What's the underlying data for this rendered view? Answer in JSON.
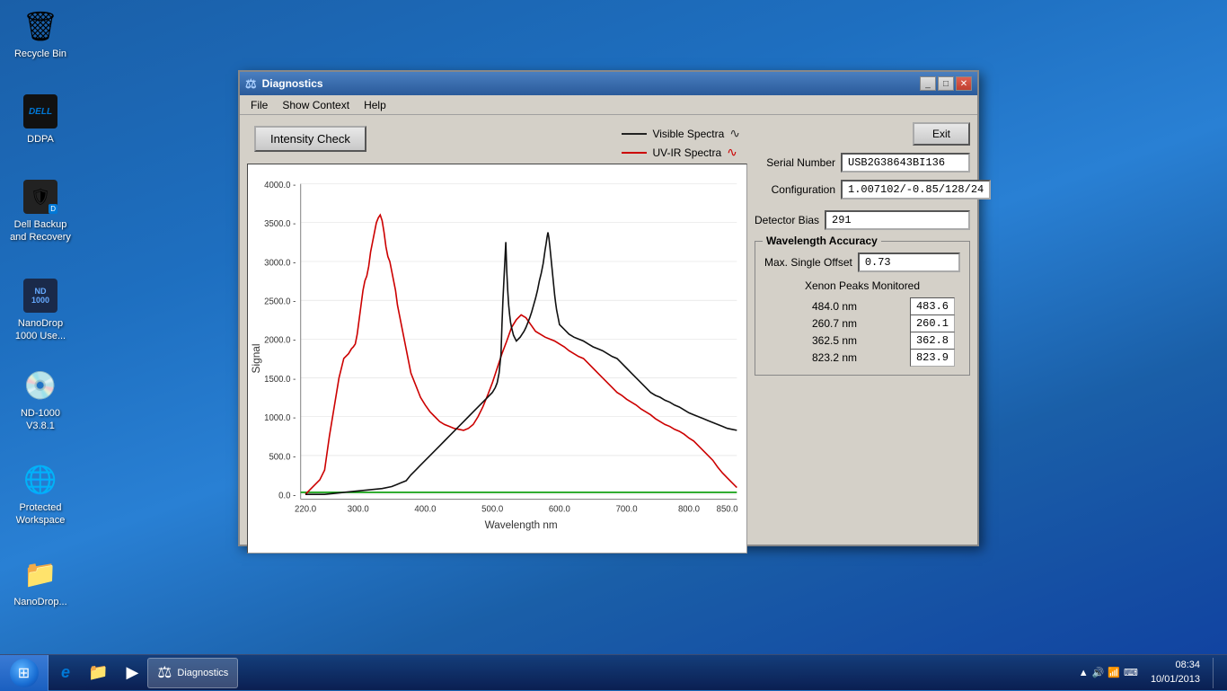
{
  "desktop": {
    "icons": [
      {
        "id": "recycle-bin",
        "label": "Recycle Bin",
        "symbol": "🗑"
      },
      {
        "id": "ddpa",
        "label": "DDPA",
        "symbol": "🛡"
      },
      {
        "id": "dell-backup",
        "label": "Dell Backup\nand Recovery",
        "symbol": "DELL"
      },
      {
        "id": "nanodrop-use",
        "label": "NanoDrop\n1000 Use...",
        "symbol": "ND"
      },
      {
        "id": "nd-1000",
        "label": "ND-1000\nV3.8.1",
        "symbol": "📀"
      },
      {
        "id": "protected-workspace",
        "label": "Protected\nWorkspace",
        "symbol": "🌐"
      },
      {
        "id": "nanodrop-folder",
        "label": "NanoDrop...",
        "symbol": "📁"
      }
    ]
  },
  "taskbar": {
    "start_label": "",
    "items": [
      {
        "id": "ie",
        "symbol": "e",
        "label": ""
      },
      {
        "id": "explorer",
        "symbol": "📁",
        "label": ""
      },
      {
        "id": "media",
        "symbol": "▶",
        "label": ""
      },
      {
        "id": "diagnostics",
        "symbol": "⚖",
        "label": "Diagnostics",
        "active": true
      }
    ],
    "clock_time": "08:34",
    "clock_date": "10/01/2013"
  },
  "window": {
    "title": "Diagnostics",
    "menu": [
      "File",
      "Show Context",
      "Help"
    ],
    "buttons": {
      "intensity_check": "Intensity Check",
      "exit": "Exit"
    },
    "legend": {
      "visible_spectra": "Visible Spectra",
      "uv_ir_spectra": "UV-IR Spectra"
    },
    "fields": {
      "serial_number_label": "Serial Number",
      "serial_number_value": "USB2G38643BI136",
      "configuration_label": "Configuration",
      "configuration_value": "1.007102/-0.85/128/24",
      "detector_bias_label": "Detector Bias",
      "detector_bias_value": "291"
    },
    "wavelength_accuracy": {
      "title": "Wavelength Accuracy",
      "max_single_offset_label": "Max. Single Offset",
      "max_single_offset_value": "0.73",
      "xenon_peaks_label": "Xenon Peaks Monitored",
      "peaks": [
        {
          "expected": "484.0 nm",
          "measured": "483.6"
        },
        {
          "expected": "260.7 nm",
          "measured": "260.1"
        },
        {
          "expected": "362.5 nm",
          "measured": "362.8"
        },
        {
          "expected": "823.2 nm",
          "measured": "823.9"
        }
      ]
    },
    "chart": {
      "x_label": "Wavelength nm",
      "y_label": "Signal",
      "x_min": "220.0",
      "x_max": "850.0",
      "y_ticks": [
        "4000.0",
        "3500.0",
        "3000.0",
        "2500.0",
        "2000.0",
        "1500.0",
        "1000.0",
        "500.0",
        "0.0"
      ],
      "x_ticks": [
        "220.0",
        "300.0",
        "400.0",
        "500.0",
        "600.0",
        "700.0",
        "800.0",
        "850.0"
      ]
    }
  }
}
